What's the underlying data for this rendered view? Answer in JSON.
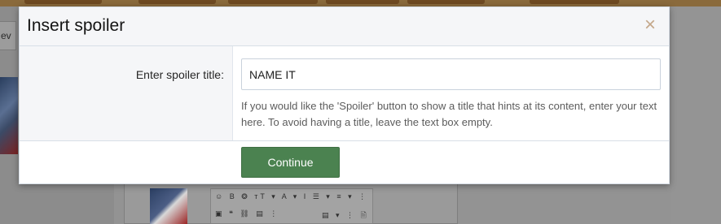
{
  "background": {
    "prev_label": "ev",
    "editor_toolbar_row1": "☺ B ❂ ᴛT ▾ A ▾ I ☰ ▾ ≡ ▾ ⋮",
    "editor_toolbar_row2": "▣ ❝ ⛓ ▤ ⋮",
    "editor_toolbar_row2_right": "▤ ▾ ⋮ 🗎"
  },
  "modal": {
    "title": "Insert spoiler",
    "close_glyph": "×",
    "field_label": "Enter spoiler title:",
    "input_value": "NAME IT",
    "hint": "If you would like the 'Spoiler' button to show a title that hints at its content, enter your text here. To avoid having a title, leave the text box empty.",
    "continue_label": "Continue"
  },
  "colors": {
    "continue_button": "#4b8250",
    "close_icon": "#c4a88b",
    "header_bg": "#f5f6f8"
  },
  "icons": {
    "close": "close-icon"
  }
}
